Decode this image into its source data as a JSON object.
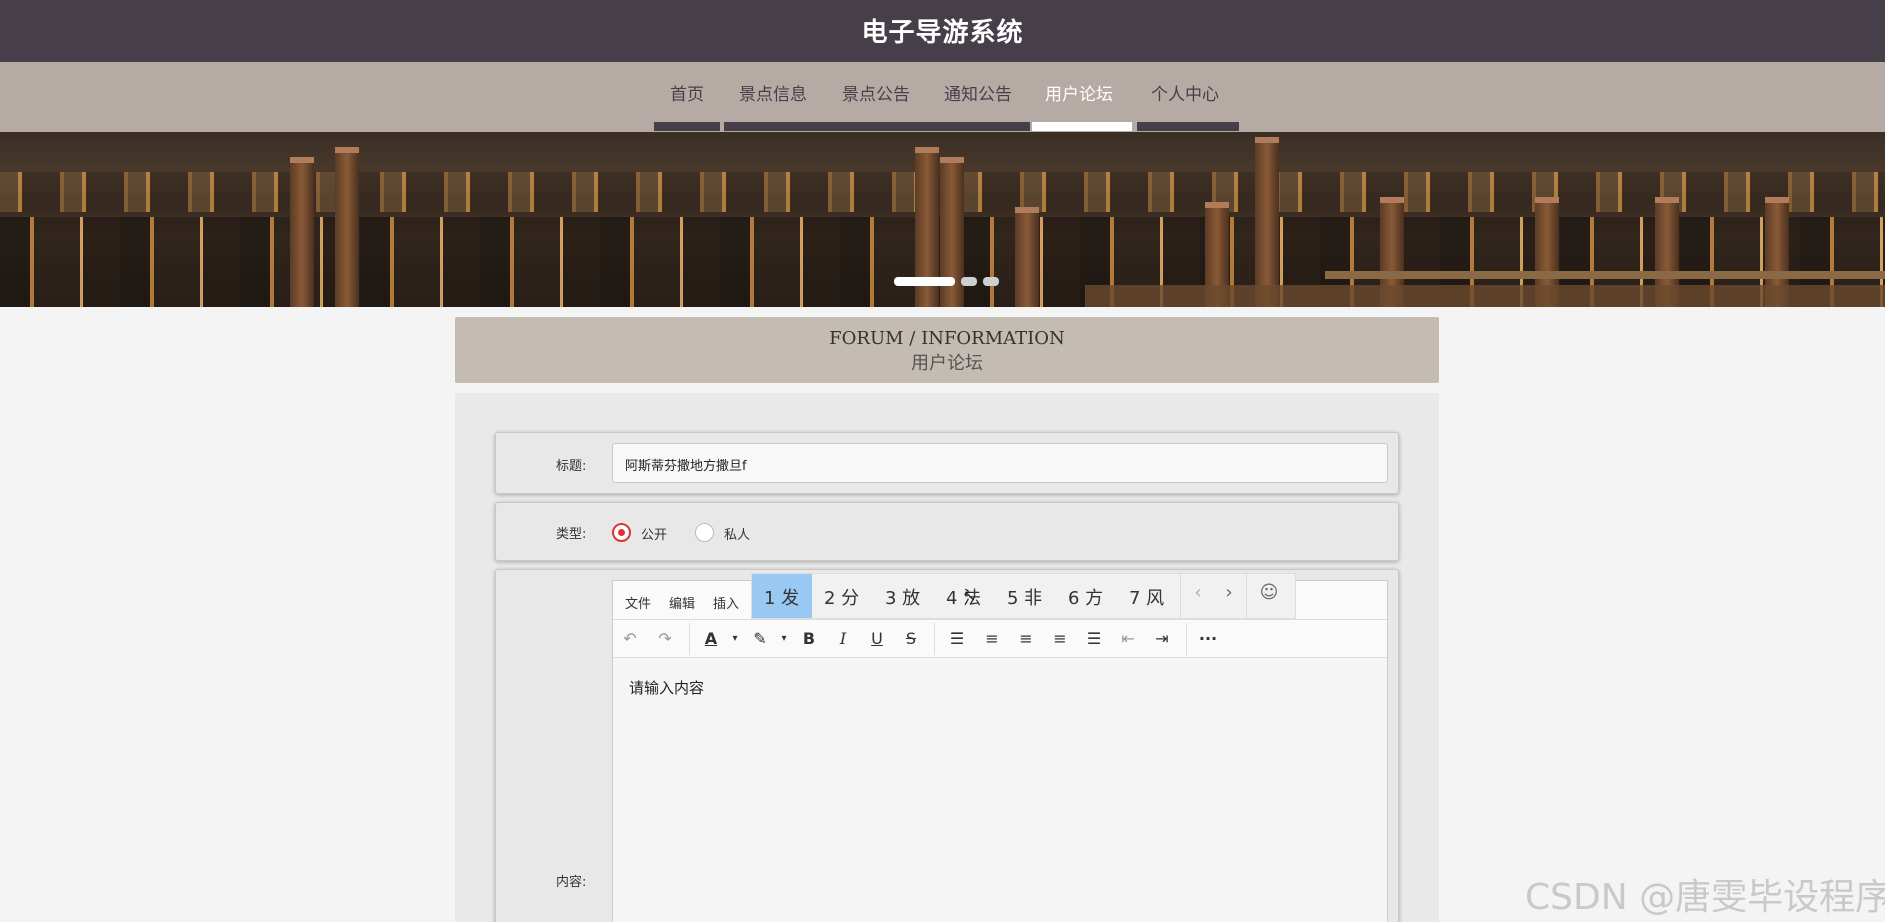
{
  "header": {
    "site_title": "电子导游系统"
  },
  "nav": {
    "items": [
      {
        "label": "首页"
      },
      {
        "label": "景点信息"
      },
      {
        "label": "景点公告"
      },
      {
        "label": "通知公告"
      },
      {
        "label": "用户论坛",
        "active": true
      },
      {
        "label": "个人中心"
      }
    ]
  },
  "banner": {
    "slide_count": 3,
    "active_slide": 1
  },
  "section": {
    "title_en": "FORUM / INFORMATION",
    "title_cn": "用户论坛"
  },
  "form": {
    "title_label": "标题:",
    "title_value": "阿斯蒂芬撒地方撒旦f",
    "type_label": "类型:",
    "type_options": [
      {
        "label": "公开",
        "selected": true
      },
      {
        "label": "私人",
        "selected": false
      }
    ],
    "content_label": "内容:"
  },
  "editor": {
    "menu": [
      "文件",
      "编辑",
      "插入"
    ],
    "placeholder": "请输入内容",
    "toolbar_icons": [
      "undo-icon",
      "redo-icon",
      "font-color-icon",
      "highlight-icon",
      "bold-icon",
      "italic-icon",
      "underline-icon",
      "strikethrough-icon",
      "line-height-icon",
      "align-left-icon",
      "align-center-icon",
      "align-right-icon",
      "align-justify-icon",
      "outdent-icon",
      "indent-icon",
      "more-icon"
    ]
  },
  "ime": {
    "candidates": [
      "1 发",
      "2 分",
      "3 放",
      "4 法",
      "5 非",
      "6 方",
      "7 风"
    ],
    "selected_index": 0
  },
  "watermark": "CSDN @唐雯毕设程序",
  "colors": {
    "topbar": "#463f4a",
    "navbar": "#b6aba4",
    "section_head": "#c4bcb2",
    "radio_accent": "#dd3333",
    "ime_selected": "#99c9f2"
  }
}
